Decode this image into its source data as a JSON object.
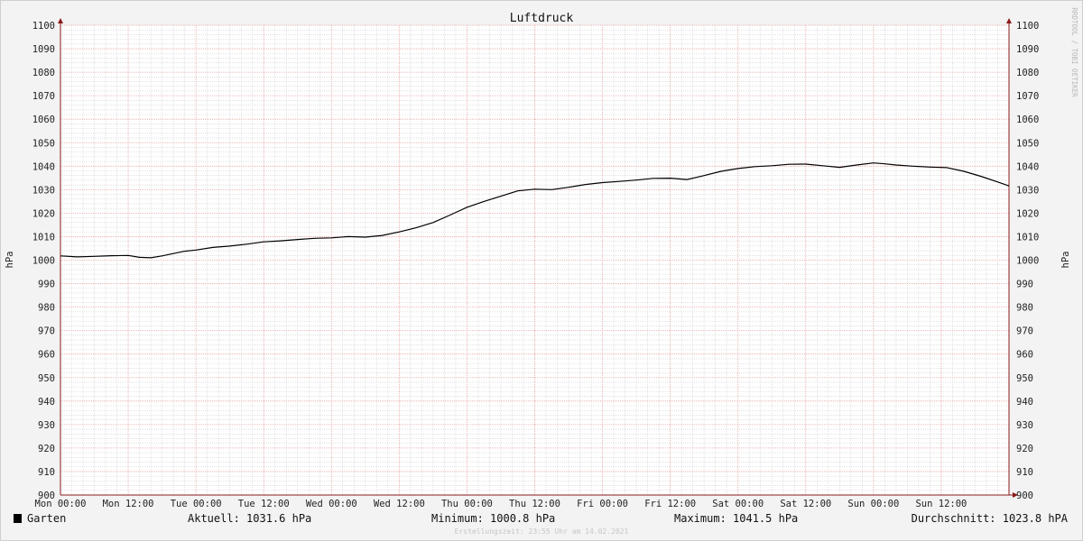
{
  "chart_data": {
    "type": "line",
    "title": "Luftdruck",
    "ylabel_left": "hPa",
    "ylabel_right": "hPa",
    "ylim": [
      900,
      1100
    ],
    "ystep": 10,
    "xlim": [
      0,
      168
    ],
    "x_unit": "hours since Mon 00:00",
    "x_ticks": [
      {
        "x": 0,
        "label": "Mon 00:00"
      },
      {
        "x": 12,
        "label": "Mon 12:00"
      },
      {
        "x": 24,
        "label": "Tue 00:00"
      },
      {
        "x": 36,
        "label": "Tue 12:00"
      },
      {
        "x": 48,
        "label": "Wed 00:00"
      },
      {
        "x": 60,
        "label": "Wed 12:00"
      },
      {
        "x": 72,
        "label": "Thu 00:00"
      },
      {
        "x": 84,
        "label": "Thu 12:00"
      },
      {
        "x": 96,
        "label": "Fri 00:00"
      },
      {
        "x": 108,
        "label": "Fri 12:00"
      },
      {
        "x": 120,
        "label": "Sat 00:00"
      },
      {
        "x": 132,
        "label": "Sat 12:00"
      },
      {
        "x": 144,
        "label": "Sun 00:00"
      },
      {
        "x": 156,
        "label": "Sun 12:00"
      }
    ],
    "grid": true,
    "series": [
      {
        "name": "Garten",
        "color": "#000000",
        "x": [
          0,
          3,
          6,
          9,
          12,
          14,
          16,
          18,
          20,
          22,
          24,
          27,
          30,
          33,
          36,
          39,
          42,
          45,
          48,
          51,
          54,
          57,
          60,
          63,
          66,
          69,
          72,
          75,
          78,
          81,
          84,
          87,
          90,
          93,
          96,
          99,
          102,
          105,
          108,
          111,
          114,
          117,
          120,
          123,
          126,
          129,
          132,
          135,
          138,
          141,
          144,
          146,
          148,
          151,
          154,
          157,
          160,
          163,
          166,
          168
        ],
        "values": [
          1001.8,
          1001.4,
          1001.6,
          1001.9,
          1002.0,
          1001.2,
          1001.0,
          1001.8,
          1002.8,
          1003.8,
          1004.3,
          1005.4,
          1006.0,
          1006.8,
          1007.8,
          1008.2,
          1008.8,
          1009.3,
          1009.5,
          1010.0,
          1009.8,
          1010.5,
          1012.0,
          1013.8,
          1016.0,
          1019.2,
          1022.5,
          1025.0,
          1027.2,
          1029.5,
          1030.2,
          1030.0,
          1031.0,
          1032.2,
          1033.0,
          1033.5,
          1034.1,
          1034.8,
          1034.9,
          1034.3,
          1036.0,
          1037.8,
          1039.0,
          1039.8,
          1040.2,
          1040.8,
          1040.9,
          1040.2,
          1039.5,
          1040.5,
          1041.4,
          1041.0,
          1040.5,
          1040.0,
          1039.6,
          1039.4,
          1037.8,
          1035.7,
          1033.3,
          1031.6
        ]
      }
    ]
  },
  "legend": {
    "swatch_color": "#000000",
    "series_label": "Garten",
    "current": "Aktuell: 1031.6 hPa",
    "minimum": "Minimum: 1000.8 hPa",
    "maximum": "Maximum: 1041.5 hPa",
    "average": "Durchschnitt: 1023.8 hPA"
  },
  "watermark": "RRDTOOL / TOBI OETIKER",
  "footnote": "Erstellungszeit: 23:55 Uhr am 14.02.2021",
  "colors": {
    "background": "#f3f3f3",
    "plot_area": "#ffffff",
    "major_grid": "#e8a0a0",
    "minor_grid": "#d0d0d0",
    "axis": "#8b1a1a"
  }
}
